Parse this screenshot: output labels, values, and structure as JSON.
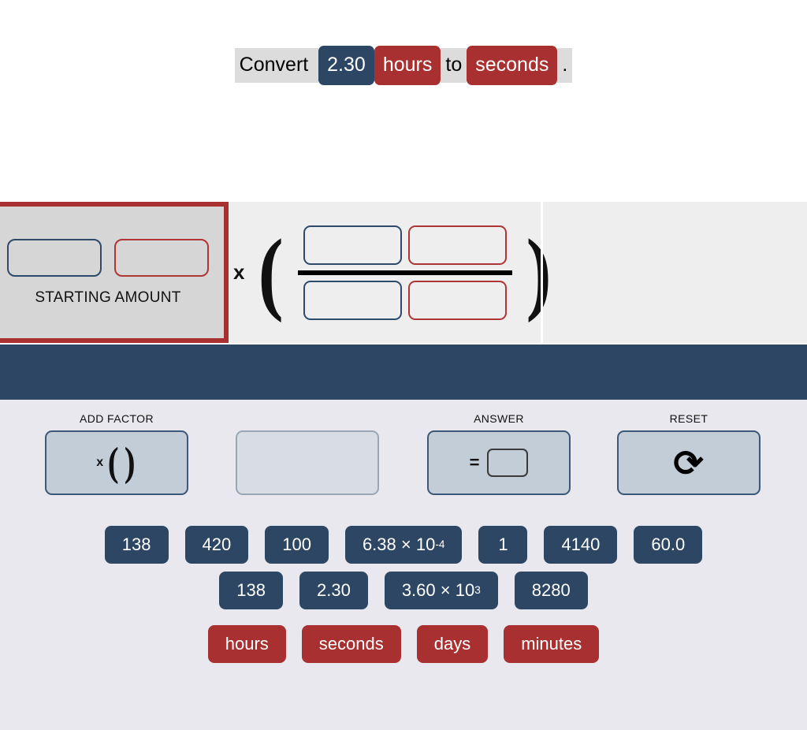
{
  "prompt": {
    "lead": "Convert ",
    "amount": "2.30",
    "from_unit": "hours",
    "connector": "to",
    "to_unit": "seconds",
    "period": "."
  },
  "work_area": {
    "starting_panel": {
      "label": "STARTING AMOUNT",
      "value_slot": "",
      "unit_slot": ""
    },
    "factor": {
      "multiplier": "x",
      "open_paren": "(",
      "close_paren": ")",
      "numerator_value": "",
      "numerator_unit": "",
      "denominator_value": "",
      "denominator_unit": ""
    }
  },
  "controls": [
    {
      "name": "add-factor",
      "label": "ADD FACTOR",
      "glyph_x": "x",
      "glyph_open": "(",
      "glyph_close": ")"
    },
    {
      "name": "empty-slot",
      "label": "",
      "glyph_x": "",
      "glyph_open": "",
      "glyph_close": ""
    },
    {
      "name": "answer",
      "label": "ANSWER",
      "equals": "=",
      "answer_value": ""
    },
    {
      "name": "reset",
      "label": "RESET",
      "icon": "undo-arrow-icon",
      "glyph": "⟲"
    }
  ],
  "tiles": {
    "row1": [
      {
        "text": "138"
      },
      {
        "text": "420"
      },
      {
        "text": "100"
      },
      {
        "text": "6.38 × 10",
        "sup": "-4"
      },
      {
        "text": "1"
      },
      {
        "text": "4140"
      },
      {
        "text": "60.0"
      }
    ],
    "row2": [
      {
        "text": "138"
      },
      {
        "text": "2.30"
      },
      {
        "text": "3.60 × 10",
        "sup": "3"
      },
      {
        "text": "8280"
      }
    ],
    "units": [
      {
        "text": "hours"
      },
      {
        "text": "seconds"
      },
      {
        "text": "days"
      },
      {
        "text": "minutes"
      }
    ]
  },
  "colors": {
    "navy": "#2d4663",
    "red": "#a93030",
    "panel_bg": "#e8e8ee",
    "work_bg": "#eeeeee",
    "starting_bg": "#d6d6d6",
    "button_bg": "#c3cdd8"
  }
}
